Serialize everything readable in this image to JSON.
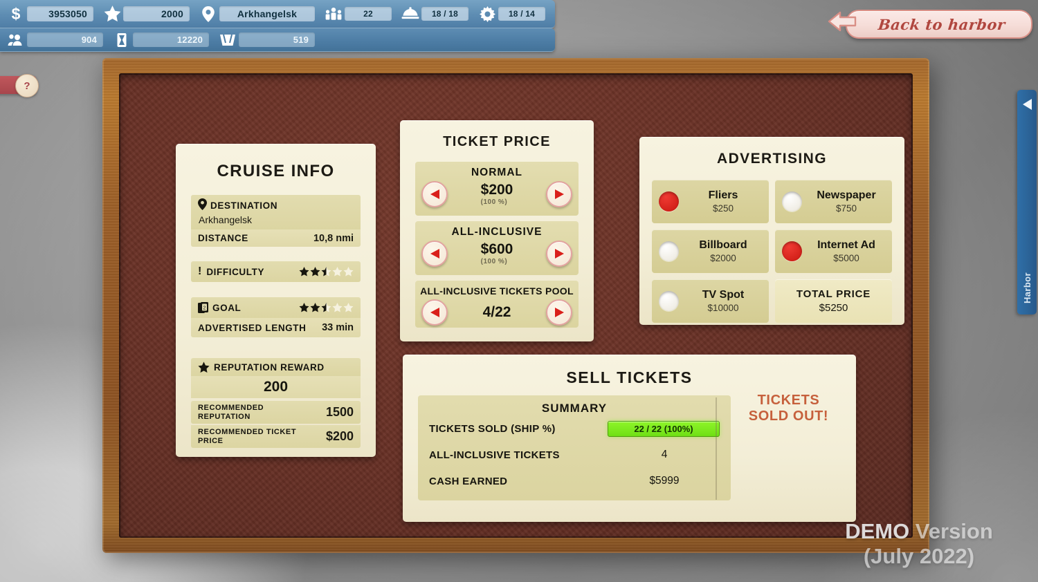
{
  "hud": {
    "row1": [
      {
        "icon": "dollar-icon",
        "value": "3953050"
      },
      {
        "icon": "star-icon",
        "value": "2000"
      },
      {
        "icon": "map-pin-icon",
        "value": "Arkhangelsk"
      },
      {
        "icon": "passengers-icon",
        "value": "22"
      },
      {
        "icon": "food-cloche-icon",
        "value": "18 / 18"
      },
      {
        "icon": "gear-icon",
        "value": "18 / 14"
      }
    ],
    "row2": [
      {
        "icon": "crew-icon",
        "value": "904"
      },
      {
        "icon": "fuel-icon",
        "value": "12220"
      },
      {
        "icon": "basket-icon",
        "value": "519"
      }
    ]
  },
  "help_button": {
    "label": "?"
  },
  "back_to_harbor": {
    "label": "Back to harbor"
  },
  "harbor_tab": {
    "label": "Harbor"
  },
  "cruise_info": {
    "title": "CRUISE INFO",
    "destination_label": "DESTINATION",
    "destination_value": "Arkhangelsk",
    "distance_label": "DISTANCE",
    "distance_value": "10,8 nmi",
    "difficulty_label": "DIFFICULTY",
    "difficulty_stars": 2.5,
    "goal_label": "GOAL",
    "goal_stars": 2.5,
    "advertised_length_label": "ADVERTISED LENGTH",
    "advertised_length_value": "33 min",
    "reputation_reward_label": "REPUTATION REWARD",
    "reputation_reward_value": "200",
    "recommended_reputation_label": "RECOMMENDED REPUTATION",
    "recommended_reputation_value": "1500",
    "recommended_ticket_price_label": "RECOMMENDED TICKET PRICE",
    "recommended_ticket_price_value": "$200"
  },
  "ticket_price": {
    "title": "TICKET PRICE",
    "rows": [
      {
        "name": "NORMAL",
        "value": "$200",
        "percent": "(100 %)"
      },
      {
        "name": "ALL-INCLUSIVE",
        "value": "$600",
        "percent": "(100 %)"
      },
      {
        "name": "ALL-INCLUSIVE TICKETS POOL",
        "value": "4/22",
        "percent": ""
      }
    ]
  },
  "advertising": {
    "title": "ADVERTISING",
    "options": [
      {
        "name": "Fliers",
        "price": "$250",
        "selected": true
      },
      {
        "name": "Newspaper",
        "price": "$750",
        "selected": false
      },
      {
        "name": "Billboard",
        "price": "$2000",
        "selected": false
      },
      {
        "name": "Internet Ad",
        "price": "$5000",
        "selected": true
      },
      {
        "name": "TV Spot",
        "price": "$10000",
        "selected": false
      }
    ],
    "total_label": "TOTAL PRICE",
    "total_value": "$5250"
  },
  "sell_tickets": {
    "title": "SELL TICKETS",
    "summary_title": "SUMMARY",
    "rows": [
      {
        "label": "TICKETS SOLD (SHIP %)",
        "value": "22 / 22 (100%)",
        "badge": true
      },
      {
        "label": "ALL-INCLUSIVE TICKETS",
        "value": "4",
        "badge": false
      },
      {
        "label": "CASH EARNED",
        "value": "$5999",
        "badge": false
      }
    ],
    "sold_out_line1": "TICKETS",
    "sold_out_line2": "SOLD OUT!"
  },
  "watermark": {
    "line1_strong": "DEMO",
    "line1_rest": " Version",
    "line2": "(July 2022)"
  },
  "colors": {
    "accent_red": "#c91710",
    "paper": "#f3eed7",
    "row": "#dcd5a2",
    "wood": "#9c5f28",
    "cork": "#6b3227",
    "badge_green": "#7ee71d",
    "sold_out": "#c6603c",
    "hud_blue": "#5d8cb2"
  }
}
